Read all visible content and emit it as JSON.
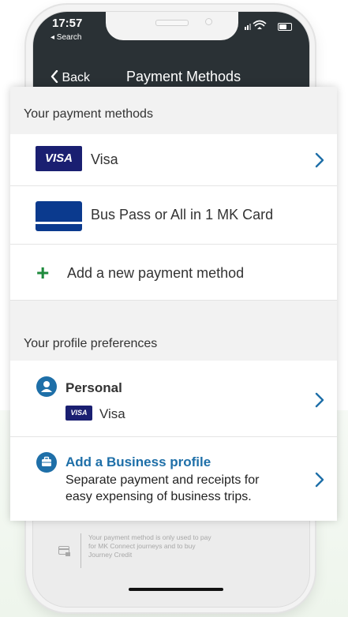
{
  "status_bar": {
    "time": "17:57",
    "back_app": "◂ Search"
  },
  "nav": {
    "back_label": "Back",
    "title": "Payment Methods"
  },
  "payment_section": {
    "header": "Your payment methods",
    "methods": [
      {
        "badge": "VISA",
        "label": "Visa",
        "icon": "visa-card-icon"
      },
      {
        "label": "Bus Pass or All in 1 MK Card",
        "icon": "bus-pass-card-icon"
      }
    ],
    "add_label": "Add a new payment method"
  },
  "profile_section": {
    "header": "Your profile preferences",
    "personal": {
      "title": "Personal",
      "badge": "VISA",
      "method": "Visa"
    },
    "business": {
      "title": "Add a Business profile",
      "desc_line1": "Separate payment and receipts for",
      "desc_line2": "easy expensing of business trips."
    }
  },
  "footer": {
    "info_line1": "Your payment method is only used to pay",
    "info_line2": "for MK Connect journeys and to buy",
    "info_line3": "Journey Credit"
  },
  "colors": {
    "visa_blue": "#1a1f71",
    "accent_blue": "#1e6fa8",
    "plus_green": "#1e8a3c",
    "nav_dark": "#2a3135"
  }
}
